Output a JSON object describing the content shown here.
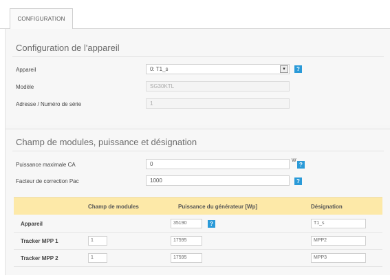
{
  "tabs": [
    {
      "label": "CONFIGURATION"
    }
  ],
  "device_section": {
    "title": "Configuration de l'appareil",
    "device_label": "Appareil",
    "device_value": "0: T1_s",
    "model_label": "Modèle",
    "model_value": "SG30KTL",
    "address_label": "Adresse / Numéro de série",
    "address_value": "1"
  },
  "modules_section": {
    "title": "Champ de modules, puissance et désignation",
    "max_power_label": "Puissance maximale CA",
    "max_power_value": "0",
    "max_power_unit": "W",
    "correction_label": "Facteur de correction Pac",
    "correction_value": "1000"
  },
  "help_icon_text": "?",
  "table": {
    "headers": [
      "Champ de modules",
      "Puissance du générateur [Wp]",
      "Désignation"
    ],
    "rows": [
      {
        "label": "Appareil",
        "field": "",
        "power": "35190",
        "designation": "T1_s"
      },
      {
        "label": "Tracker MPP 1",
        "field": "1",
        "power": "17595",
        "designation": "MPP2"
      },
      {
        "label": "Tracker MPP 2",
        "field": "1",
        "power": "17595",
        "designation": "MPP3"
      }
    ]
  }
}
